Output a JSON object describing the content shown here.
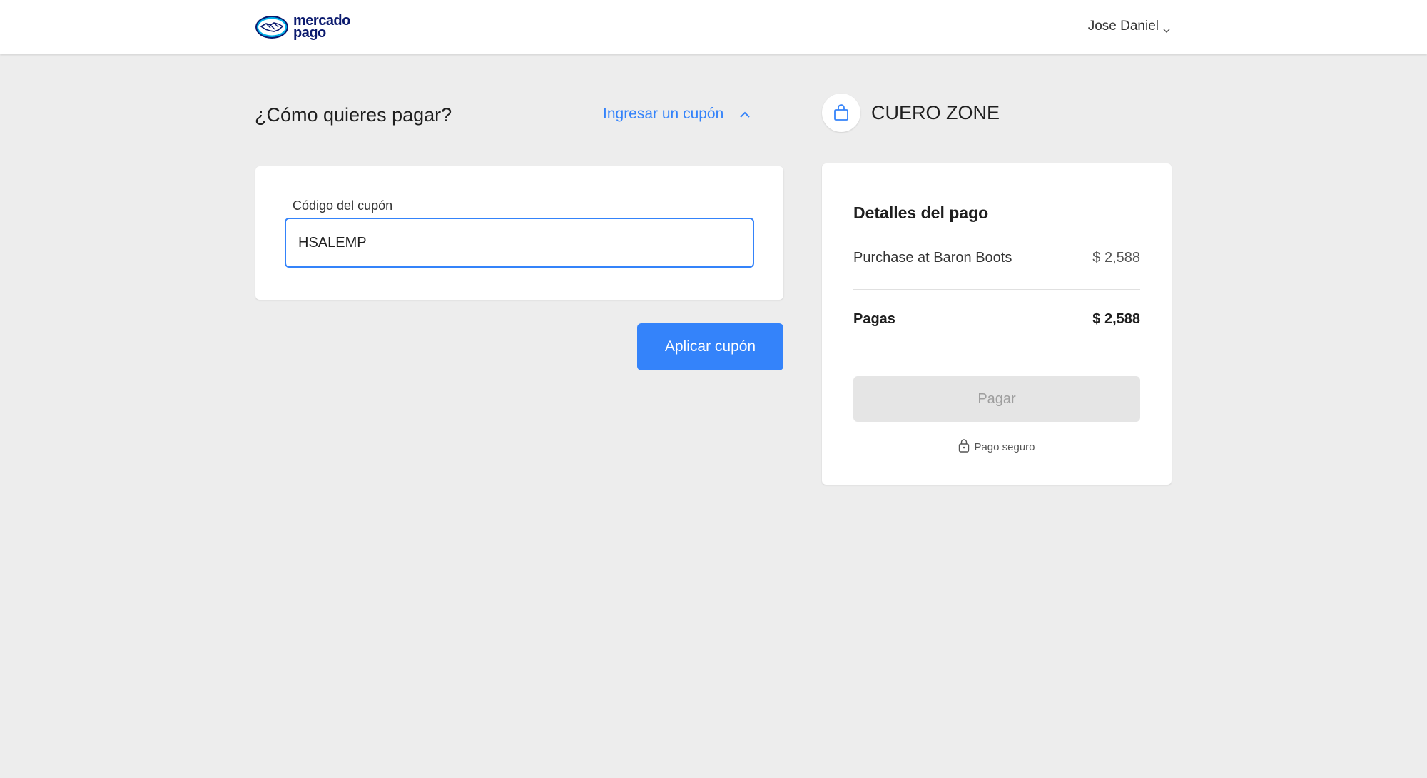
{
  "header": {
    "logo_line1": "mercado",
    "logo_line2": "pago",
    "user_name": "Jose Daniel"
  },
  "payment": {
    "title": "¿Cómo quieres pagar?",
    "coupon_toggle_label": "Ingresar un cupón",
    "coupon_field_label": "Código del cupón",
    "coupon_value": "HSALEMP",
    "apply_button_label": "Aplicar cupón"
  },
  "store": {
    "name": "CUERO ZONE"
  },
  "details": {
    "title": "Detalles del pago",
    "item_label": "Purchase at Baron Boots",
    "item_amount": "$ 2,588",
    "total_label": "Pagas",
    "total_amount": "$ 2,588",
    "pay_button_label": "Pagar",
    "secure_label": "Pago seguro"
  },
  "colors": {
    "accent": "#3483fa",
    "background": "#ededed",
    "brand_navy": "#0b1a6e",
    "disabled_button": "#e5e5e5"
  }
}
